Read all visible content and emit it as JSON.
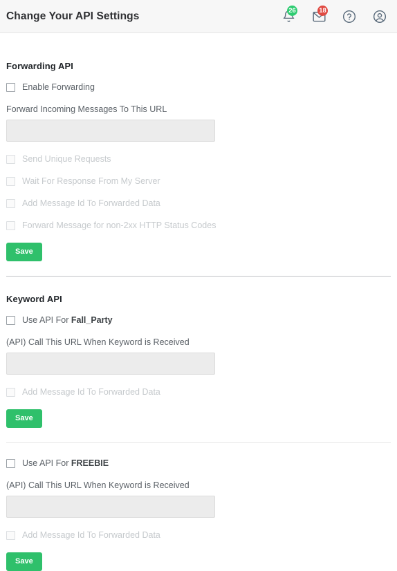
{
  "header": {
    "title": "Change Your API Settings",
    "icons": [
      {
        "name": "notifications-bell-icon",
        "badge": "26",
        "badge_color": "#2ecc71"
      },
      {
        "name": "messages-envelope-icon",
        "badge": "18",
        "badge_color": "#e04a42"
      },
      {
        "name": "help-question-icon",
        "badge": ""
      },
      {
        "name": "user-account-icon",
        "badge": ""
      }
    ]
  },
  "forwarding": {
    "title": "Forwarding API",
    "enable_label": "Enable Forwarding",
    "url_label": "Forward Incoming Messages To This URL",
    "url_value": "",
    "url_placeholder": "",
    "options": [
      "Send Unique Requests",
      "Wait For Response From My Server",
      "Add Message Id To Forwarded Data",
      "Forward Message for non-2xx HTTP Status Codes"
    ],
    "save_label": "Save"
  },
  "keyword_section": {
    "title": "Keyword API",
    "entries": [
      {
        "use_api_prefix": "Use API For ",
        "keyword": "Fall_Party",
        "url_label": "(API) Call This URL When Keyword is Received",
        "url_value": "",
        "url_placeholder": "",
        "add_message_id_label": "Add Message Id To Forwarded Data",
        "save_label": "Save"
      },
      {
        "use_api_prefix": "Use API For ",
        "keyword": "FREEBIE",
        "url_label": "(API) Call This URL When Keyword is Received",
        "url_value": "",
        "url_placeholder": "",
        "add_message_id_label": "Add Message Id To Forwarded Data",
        "save_label": "Save"
      }
    ]
  },
  "theme": {
    "accent_green": "#2fc06b",
    "badge_red": "#e04a42",
    "header_bg": "#f7f7f7",
    "input_bg": "#ececec"
  }
}
